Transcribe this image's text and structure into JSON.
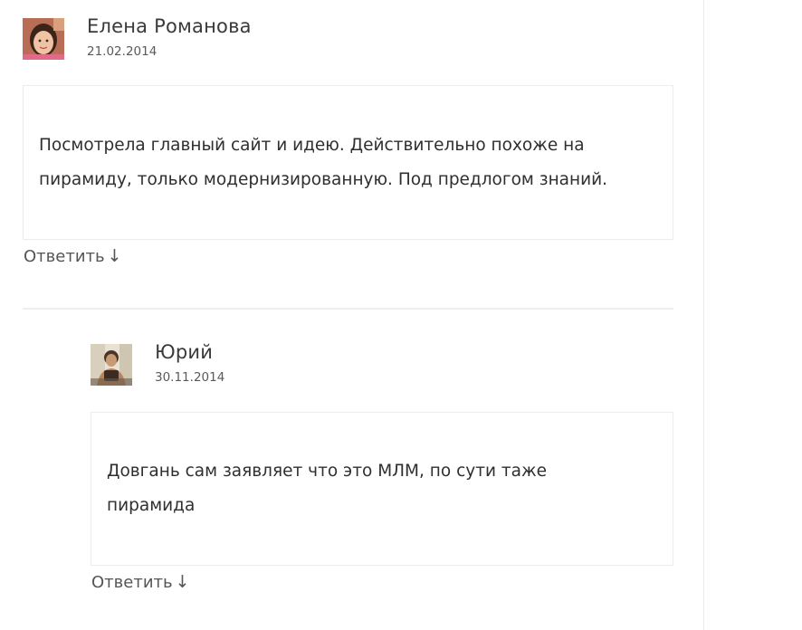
{
  "comments": [
    {
      "author": "Елена Романова",
      "date": "21.02.2014",
      "text": "Посмотрела главный сайт и идею. Действительно похоже на пирамиду, только модернизированную. Под предлогом знаний.",
      "reply_label": "Ответить",
      "reply_arrow": "↓",
      "avatar_icon": "user-avatar-photo"
    },
    {
      "author": "Юрий",
      "date": "30.11.2014",
      "text": "Довгань сам заявляет что это МЛМ, по сути таже пирамида",
      "reply_label": "Ответить",
      "reply_arrow": "↓",
      "avatar_icon": "user-avatar-photo"
    }
  ]
}
